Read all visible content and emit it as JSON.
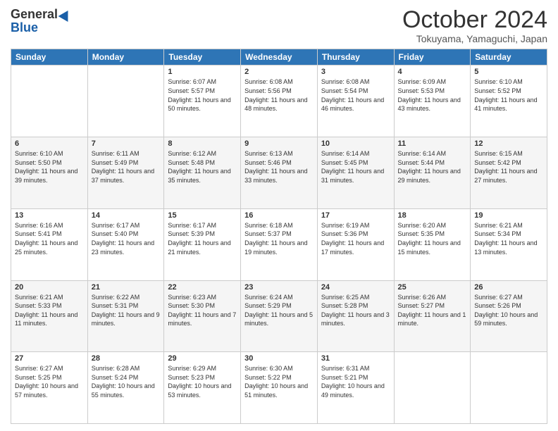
{
  "header": {
    "logo_general": "General",
    "logo_blue": "Blue",
    "month_title": "October 2024",
    "location": "Tokuyama, Yamaguchi, Japan"
  },
  "weekdays": [
    "Sunday",
    "Monday",
    "Tuesday",
    "Wednesday",
    "Thursday",
    "Friday",
    "Saturday"
  ],
  "weeks": [
    [
      {
        "day": "",
        "info": ""
      },
      {
        "day": "",
        "info": ""
      },
      {
        "day": "1",
        "info": "Sunrise: 6:07 AM\nSunset: 5:57 PM\nDaylight: 11 hours and 50 minutes."
      },
      {
        "day": "2",
        "info": "Sunrise: 6:08 AM\nSunset: 5:56 PM\nDaylight: 11 hours and 48 minutes."
      },
      {
        "day": "3",
        "info": "Sunrise: 6:08 AM\nSunset: 5:54 PM\nDaylight: 11 hours and 46 minutes."
      },
      {
        "day": "4",
        "info": "Sunrise: 6:09 AM\nSunset: 5:53 PM\nDaylight: 11 hours and 43 minutes."
      },
      {
        "day": "5",
        "info": "Sunrise: 6:10 AM\nSunset: 5:52 PM\nDaylight: 11 hours and 41 minutes."
      }
    ],
    [
      {
        "day": "6",
        "info": "Sunrise: 6:10 AM\nSunset: 5:50 PM\nDaylight: 11 hours and 39 minutes."
      },
      {
        "day": "7",
        "info": "Sunrise: 6:11 AM\nSunset: 5:49 PM\nDaylight: 11 hours and 37 minutes."
      },
      {
        "day": "8",
        "info": "Sunrise: 6:12 AM\nSunset: 5:48 PM\nDaylight: 11 hours and 35 minutes."
      },
      {
        "day": "9",
        "info": "Sunrise: 6:13 AM\nSunset: 5:46 PM\nDaylight: 11 hours and 33 minutes."
      },
      {
        "day": "10",
        "info": "Sunrise: 6:14 AM\nSunset: 5:45 PM\nDaylight: 11 hours and 31 minutes."
      },
      {
        "day": "11",
        "info": "Sunrise: 6:14 AM\nSunset: 5:44 PM\nDaylight: 11 hours and 29 minutes."
      },
      {
        "day": "12",
        "info": "Sunrise: 6:15 AM\nSunset: 5:42 PM\nDaylight: 11 hours and 27 minutes."
      }
    ],
    [
      {
        "day": "13",
        "info": "Sunrise: 6:16 AM\nSunset: 5:41 PM\nDaylight: 11 hours and 25 minutes."
      },
      {
        "day": "14",
        "info": "Sunrise: 6:17 AM\nSunset: 5:40 PM\nDaylight: 11 hours and 23 minutes."
      },
      {
        "day": "15",
        "info": "Sunrise: 6:17 AM\nSunset: 5:39 PM\nDaylight: 11 hours and 21 minutes."
      },
      {
        "day": "16",
        "info": "Sunrise: 6:18 AM\nSunset: 5:37 PM\nDaylight: 11 hours and 19 minutes."
      },
      {
        "day": "17",
        "info": "Sunrise: 6:19 AM\nSunset: 5:36 PM\nDaylight: 11 hours and 17 minutes."
      },
      {
        "day": "18",
        "info": "Sunrise: 6:20 AM\nSunset: 5:35 PM\nDaylight: 11 hours and 15 minutes."
      },
      {
        "day": "19",
        "info": "Sunrise: 6:21 AM\nSunset: 5:34 PM\nDaylight: 11 hours and 13 minutes."
      }
    ],
    [
      {
        "day": "20",
        "info": "Sunrise: 6:21 AM\nSunset: 5:33 PM\nDaylight: 11 hours and 11 minutes."
      },
      {
        "day": "21",
        "info": "Sunrise: 6:22 AM\nSunset: 5:31 PM\nDaylight: 11 hours and 9 minutes."
      },
      {
        "day": "22",
        "info": "Sunrise: 6:23 AM\nSunset: 5:30 PM\nDaylight: 11 hours and 7 minutes."
      },
      {
        "day": "23",
        "info": "Sunrise: 6:24 AM\nSunset: 5:29 PM\nDaylight: 11 hours and 5 minutes."
      },
      {
        "day": "24",
        "info": "Sunrise: 6:25 AM\nSunset: 5:28 PM\nDaylight: 11 hours and 3 minutes."
      },
      {
        "day": "25",
        "info": "Sunrise: 6:26 AM\nSunset: 5:27 PM\nDaylight: 11 hours and 1 minute."
      },
      {
        "day": "26",
        "info": "Sunrise: 6:27 AM\nSunset: 5:26 PM\nDaylight: 10 hours and 59 minutes."
      }
    ],
    [
      {
        "day": "27",
        "info": "Sunrise: 6:27 AM\nSunset: 5:25 PM\nDaylight: 10 hours and 57 minutes."
      },
      {
        "day": "28",
        "info": "Sunrise: 6:28 AM\nSunset: 5:24 PM\nDaylight: 10 hours and 55 minutes."
      },
      {
        "day": "29",
        "info": "Sunrise: 6:29 AM\nSunset: 5:23 PM\nDaylight: 10 hours and 53 minutes."
      },
      {
        "day": "30",
        "info": "Sunrise: 6:30 AM\nSunset: 5:22 PM\nDaylight: 10 hours and 51 minutes."
      },
      {
        "day": "31",
        "info": "Sunrise: 6:31 AM\nSunset: 5:21 PM\nDaylight: 10 hours and 49 minutes."
      },
      {
        "day": "",
        "info": ""
      },
      {
        "day": "",
        "info": ""
      }
    ]
  ]
}
